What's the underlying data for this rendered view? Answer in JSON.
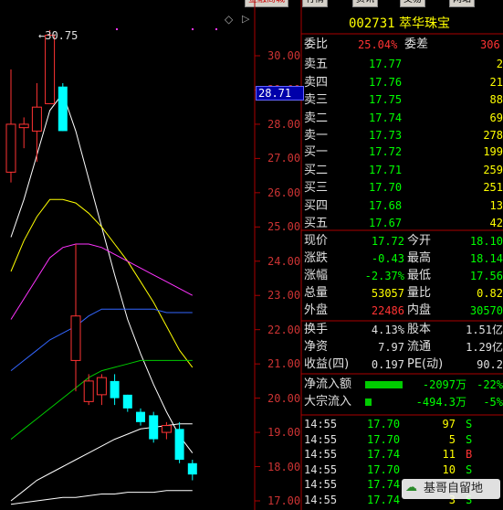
{
  "window": {
    "menu": [
      "金融商城",
      "行情",
      "资讯",
      "交易",
      "网站"
    ],
    "header_icons": [
      "diamond-icon",
      "play-right-icon"
    ]
  },
  "stock": {
    "code": "002731",
    "name": "萃华珠宝"
  },
  "price_axis": {
    "labels": [
      "30.00",
      "29.00",
      "28.00",
      "27.00",
      "26.00",
      "25.00",
      "24.00",
      "23.00",
      "22.00",
      "21.00",
      "20.00",
      "19.00",
      "18.00",
      "17.00"
    ],
    "current_price_tag": "28.71",
    "high_marker": "30.75"
  },
  "chart_data": {
    "type": "candlestick",
    "y_range": [
      16.8,
      31.4
    ],
    "candles": [
      {
        "o": 26.6,
        "c": 28.0,
        "h": 29.6,
        "l": 26.3
      },
      {
        "o": 27.9,
        "c": 28.0,
        "h": 28.2,
        "l": 27.3
      },
      {
        "o": 27.8,
        "c": 28.5,
        "h": 29.2,
        "l": 26.9
      },
      {
        "o": 28.6,
        "c": 30.6,
        "h": 30.75,
        "l": 28.6
      },
      {
        "o": 29.1,
        "c": 27.8,
        "h": 29.2,
        "l": 27.8
      },
      {
        "o": 21.1,
        "c": 22.4,
        "h": 24.5,
        "l": 20.2
      },
      {
        "o": 19.9,
        "c": 20.5,
        "h": 20.7,
        "l": 19.8
      },
      {
        "o": 20.1,
        "c": 20.6,
        "h": 20.7,
        "l": 19.8
      },
      {
        "o": 20.5,
        "c": 20.0,
        "h": 20.7,
        "l": 19.8
      },
      {
        "o": 20.1,
        "c": 19.7,
        "h": 20.1,
        "l": 19.6
      },
      {
        "o": 19.6,
        "c": 19.3,
        "h": 19.7,
        "l": 19.2
      },
      {
        "o": 19.5,
        "c": 18.8,
        "h": 19.6,
        "l": 18.7
      },
      {
        "o": 19.0,
        "c": 19.2,
        "h": 19.3,
        "l": 18.8
      },
      {
        "o": 19.1,
        "c": 18.2,
        "h": 19.3,
        "l": 18.1
      },
      {
        "o": 18.1,
        "c": 17.77,
        "h": 18.2,
        "l": 17.6
      }
    ],
    "moving_averages": [
      {
        "name": "MA-white",
        "color": "#ffffff",
        "values": [
          24.7,
          25.8,
          27.1,
          28.4,
          28.9,
          27.8,
          26.4,
          25.0,
          23.6,
          22.3,
          21.3,
          20.4,
          19.6,
          18.9,
          18.4
        ]
      },
      {
        "name": "MA-yellow",
        "color": "#ffff00",
        "values": [
          23.7,
          24.6,
          25.3,
          25.8,
          25.8,
          25.7,
          25.4,
          25.0,
          24.5,
          24.0,
          23.4,
          22.8,
          22.1,
          21.4,
          20.9
        ]
      },
      {
        "name": "MA-magenta",
        "color": "#ff33ff",
        "values": [
          22.3,
          22.9,
          23.5,
          24.1,
          24.4,
          24.5,
          24.5,
          24.4,
          24.2,
          24.0,
          23.8,
          23.6,
          23.4,
          23.2,
          23.0
        ]
      },
      {
        "name": "MA-blue",
        "color": "#3366ff",
        "values": [
          20.8,
          21.1,
          21.4,
          21.7,
          21.9,
          22.1,
          22.4,
          22.6,
          22.6,
          22.6,
          22.6,
          22.6,
          22.5,
          22.5,
          22.5
        ]
      },
      {
        "name": "MA-green",
        "color": "#00cc00",
        "values": [
          18.8,
          19.1,
          19.4,
          19.7,
          20.0,
          20.3,
          20.6,
          20.8,
          20.9,
          21.0,
          21.1,
          21.1,
          21.1,
          21.1,
          21.1
        ]
      },
      {
        "name": "MA-white-long",
        "color": "#ffffff",
        "values": [
          17.0,
          17.3,
          17.6,
          17.8,
          18.0,
          18.2,
          18.4,
          18.6,
          18.8,
          18.95,
          19.1,
          19.15,
          19.2,
          19.25,
          19.25
        ]
      },
      {
        "name": "MA-white-longest",
        "color": "#ffffff",
        "values": [
          16.9,
          16.95,
          17.0,
          17.05,
          17.1,
          17.1,
          17.15,
          17.2,
          17.2,
          17.25,
          17.25,
          17.25,
          17.3,
          17.3,
          17.3
        ]
      }
    ]
  },
  "quote": {
    "weibi_label": "委比",
    "weibi_value": "25.04%",
    "weicha_label": "委差",
    "weicha_value": "306",
    "asks": [
      {
        "label": "卖五",
        "price": "17.77",
        "vol": "2"
      },
      {
        "label": "卖四",
        "price": "17.76",
        "vol": "21"
      },
      {
        "label": "卖三",
        "price": "17.75",
        "vol": "88"
      },
      {
        "label": "卖二",
        "price": "17.74",
        "vol": "69"
      },
      {
        "label": "卖一",
        "price": "17.73",
        "vol": "278"
      }
    ],
    "bids": [
      {
        "label": "买一",
        "price": "17.72",
        "vol": "199"
      },
      {
        "label": "买二",
        "price": "17.71",
        "vol": "259"
      },
      {
        "label": "买三",
        "price": "17.70",
        "vol": "251"
      },
      {
        "label": "买四",
        "price": "17.68",
        "vol": "13"
      },
      {
        "label": "买五",
        "price": "17.67",
        "vol": "42"
      }
    ],
    "stats": [
      {
        "l1": "现价",
        "v1": "17.72",
        "c1": "#00ff00",
        "l2": "今开",
        "v2": "18.10",
        "c2": "#00ff00"
      },
      {
        "l1": "涨跌",
        "v1": "-0.43",
        "c1": "#00ff00",
        "l2": "最高",
        "v2": "18.14",
        "c2": "#00ff00"
      },
      {
        "l1": "涨幅",
        "v1": "-2.37%",
        "c1": "#00ff00",
        "l2": "最低",
        "v2": "17.56",
        "c2": "#00ff00"
      },
      {
        "l1": "总量",
        "v1": "53057",
        "c1": "#ffff00",
        "l2": "量比",
        "v2": "0.82",
        "c2": "#ffff00"
      },
      {
        "l1": "外盘",
        "v1": "22486",
        "c1": "#ff3333",
        "l2": "内盘",
        "v2": "30570",
        "c2": "#00ff00"
      }
    ],
    "stats2": [
      {
        "l1": "换手",
        "v1": "4.13%",
        "l2": "股本",
        "v2": "1.51亿"
      },
      {
        "l1": "净资",
        "v1": "7.97",
        "l2": "流通",
        "v2": "1.29亿"
      },
      {
        "l1": "收益(四)",
        "v1": "0.197",
        "l2": "PE(动)",
        "v2": "90.2"
      }
    ],
    "flows": [
      {
        "label": "净流入额",
        "value": "-2097万",
        "pct": "-22%",
        "bar_fraction": 0.9
      },
      {
        "label": "大宗流入",
        "value": "-494.3万",
        "pct": "-5%",
        "bar_fraction": 0.15
      }
    ],
    "ticks": [
      {
        "time": "14:55",
        "price": "17.70",
        "vol": "97",
        "side": "S"
      },
      {
        "time": "14:55",
        "price": "17.70",
        "vol": "5",
        "side": "S"
      },
      {
        "time": "14:55",
        "price": "17.74",
        "vol": "11",
        "side": "B"
      },
      {
        "time": "14:55",
        "price": "17.70",
        "vol": "10",
        "side": "S"
      },
      {
        "time": "14:55",
        "price": "17.74",
        "vol": "",
        "side": ""
      },
      {
        "time": "14:55",
        "price": "17.74",
        "vol": "3",
        "side": "S"
      }
    ]
  },
  "watermark": {
    "text": "基哥自留地"
  }
}
